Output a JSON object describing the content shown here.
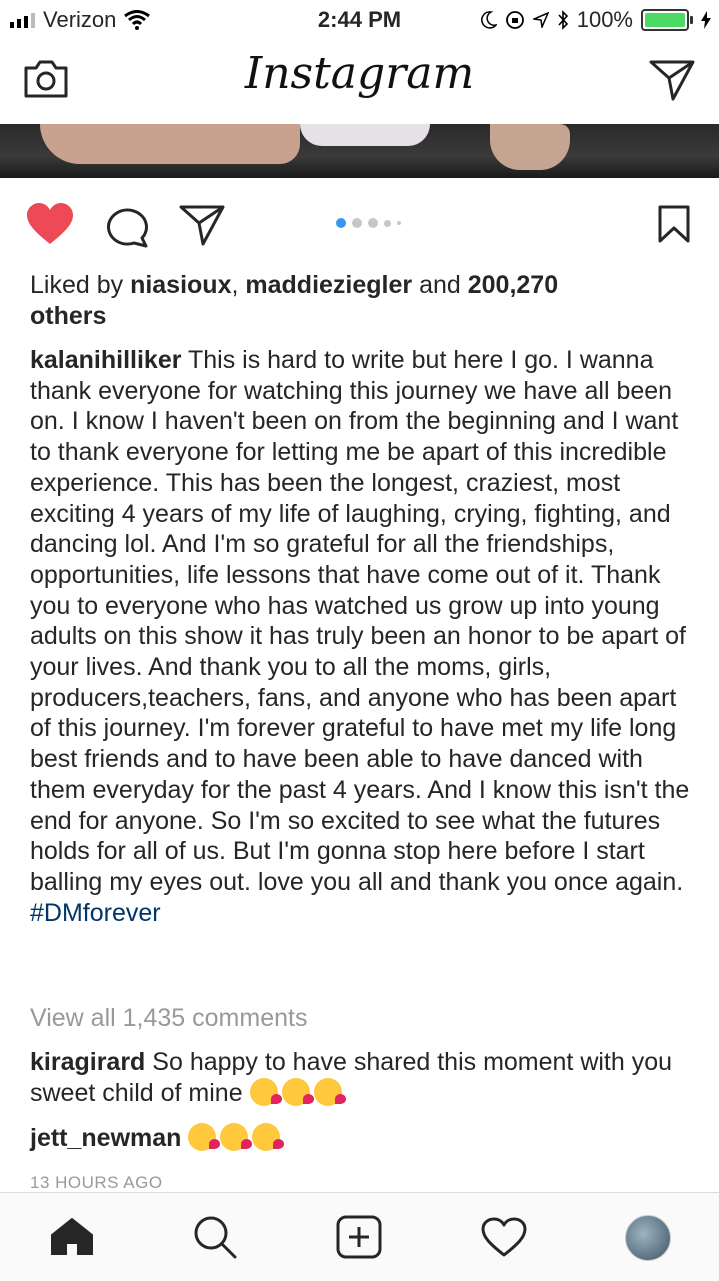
{
  "status_bar": {
    "carrier": "Verizon",
    "time": "2:44 PM",
    "battery": "100%"
  },
  "header": {
    "title": "Instagram"
  },
  "post": {
    "likes": {
      "prefix": "Liked by ",
      "user1": "niasioux",
      "separator": ", ",
      "user2": "maddieziegler",
      "conjunction": " and ",
      "count": "200,270",
      "suffix": "others"
    },
    "caption": {
      "author": "kalanihilliker",
      "text": "This is hard to write but here I go. I wanna thank everyone for watching this journey we have all been on. I know I haven't been on from the beginning and I want to thank everyone for letting me be apart of this incredible experience. This has been the longest, craziest, most exciting 4 years of my life of laughing, crying, fighting, and dancing lol. And I'm so grateful for all the friendships, opportunities, life lessons that have come out of it. Thank you to everyone who has watched us grow up into young adults on this show it has truly been an honor to be apart of your lives. And thank you to all the moms, girls, producers,teachers, fans, and anyone who has been apart of this journey. I'm forever grateful to have met my life long best friends and to have been able to have danced with them everyday for the past 4 years. And I know this isn't the end for anyone. So I'm so excited to see what the futures holds for all of us. But I'm gonna stop here before I start balling my eyes out. love you all and thank you once again.",
      "hashtag": "#DMforever"
    },
    "view_comments": "View all 1,435 comments",
    "comments": [
      {
        "user": "kiragirard",
        "text": "So happy to have shared this moment with you sweet child of mine",
        "emoji_count": 3
      },
      {
        "user": "jett_newman",
        "text": "",
        "emoji_count": 3
      }
    ],
    "timestamp": "13 HOURS AGO"
  },
  "colors": {
    "like_red": "#ed4956",
    "carousel_active": "#3897f0",
    "hashtag_blue": "#003569"
  }
}
